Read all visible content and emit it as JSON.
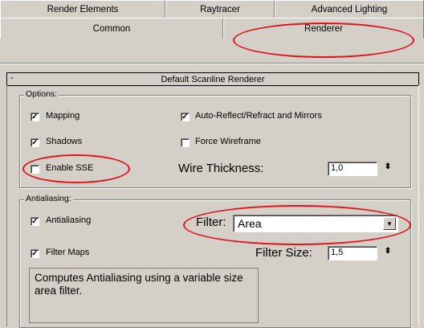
{
  "tabs_row1": [
    {
      "label": "Render Elements"
    },
    {
      "label": "Raytracer"
    },
    {
      "label": "Advanced Lighting"
    }
  ],
  "tabs_row2": [
    {
      "label": "Common"
    },
    {
      "label": "Renderer"
    }
  ],
  "rollout": {
    "collapse_symbol": "-",
    "title": "Default Scanline Renderer"
  },
  "options": {
    "title": "Options:",
    "mapping": {
      "label": "Mapping",
      "checked": true
    },
    "auto_reflect": {
      "label": "Auto-Reflect/Refract and Mirrors",
      "checked": true
    },
    "shadows": {
      "label": "Shadows",
      "checked": true
    },
    "force_wireframe": {
      "label": "Force Wireframe",
      "checked": false
    },
    "enable_sse": {
      "label": "Enable SSE",
      "checked": false
    },
    "wire_thickness": {
      "label": "Wire Thickness:",
      "value": "1,0"
    }
  },
  "antialiasing": {
    "title": "Antialiasing:",
    "antialiasing": {
      "label": "Antialiasing",
      "checked": true
    },
    "filter_maps": {
      "label": "Filter Maps",
      "checked": true
    },
    "filter": {
      "label": "Filter:",
      "value": "Area"
    },
    "filter_size": {
      "label": "Filter Size:",
      "value": "1,5"
    },
    "description": "Computes Antialiasing using a variable size area filter."
  },
  "glyphs": {
    "check": "✓",
    "dropdown": "▼",
    "spin": "⬍"
  },
  "colors": {
    "annotation": "#e0141e",
    "panel": "#d4d0c8"
  }
}
